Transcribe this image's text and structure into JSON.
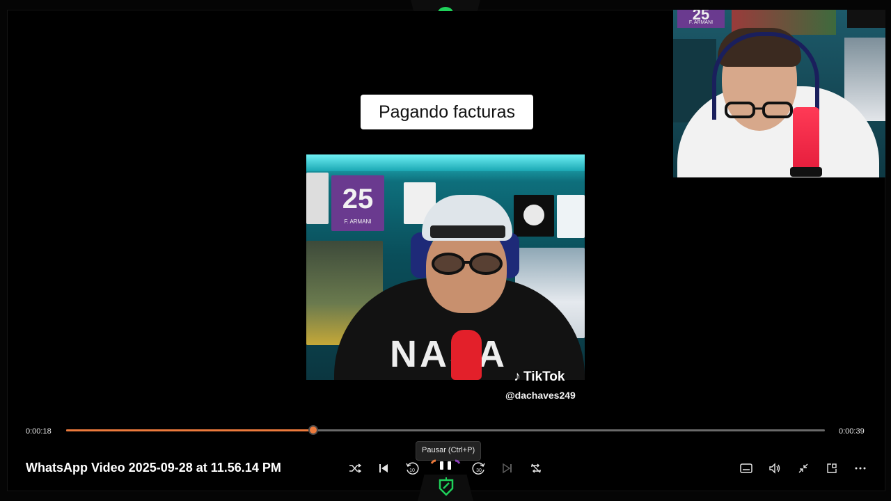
{
  "video": {
    "caption": "Pagando facturas",
    "embedded_watermark": "TikTok",
    "embedded_handle": "@dachaves249",
    "embedded_poster_number": "25",
    "embedded_poster_name": "F. ARMANI",
    "embedded_shirt_text": "NASA"
  },
  "webcam": {
    "poster_number": "25",
    "poster_name": "F. ARMANI"
  },
  "player": {
    "title": "WhatsApp Video 2025-09-28 at 11.56.14 PM",
    "current_time": "0:00:18",
    "total_time": "0:00:39",
    "progress_fraction": 0.326,
    "tooltip": "Pausar (Ctrl+P)",
    "accent_color": "#ec7a3c"
  },
  "controls": {
    "left": [
      "shuffle-icon",
      "previous-icon",
      "rewind-10-icon",
      "pause-icon",
      "forward-30-icon",
      "next-icon",
      "repeat-icon"
    ],
    "right": [
      "captions-icon",
      "volume-icon",
      "minimize-icon",
      "mini-player-icon",
      "more-icon"
    ]
  },
  "rewind_label": "10",
  "forward_label": "30"
}
